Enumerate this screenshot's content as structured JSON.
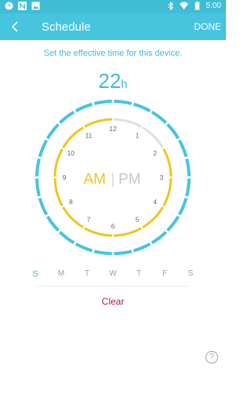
{
  "status_bar": {
    "time": "5:00",
    "left_icons": [
      "clock-icon",
      "n-notification-icon",
      "image-icon"
    ],
    "right_icons": [
      "bluetooth-icon",
      "wifi-icon",
      "battery-icon"
    ]
  },
  "app_bar": {
    "title": "Schedule",
    "done_label": "DONE",
    "background": "#47c4de"
  },
  "subtitle": "Set the effective time for this device.",
  "selected_hour": {
    "value": "22",
    "unit": "h"
  },
  "clock": {
    "labels": [
      "12",
      "1",
      "2",
      "3",
      "4",
      "5",
      "6",
      "7",
      "8",
      "9",
      "10",
      "11"
    ],
    "am_label": "AM",
    "separator": "|",
    "pm_label": "PM",
    "active_period": "AM",
    "active_color": "#f0c41e",
    "outer_ring_color": "#47c4de",
    "inactive_color": "#e0e0e0"
  },
  "weekdays": [
    {
      "label": "S",
      "active": true
    },
    {
      "label": "M",
      "active": false
    },
    {
      "label": "T",
      "active": false
    },
    {
      "label": "W",
      "active": false
    },
    {
      "label": "T",
      "active": false
    },
    {
      "label": "F",
      "active": false
    },
    {
      "label": "S",
      "active": false
    }
  ],
  "clear_label": "Clear",
  "help_label": "?"
}
